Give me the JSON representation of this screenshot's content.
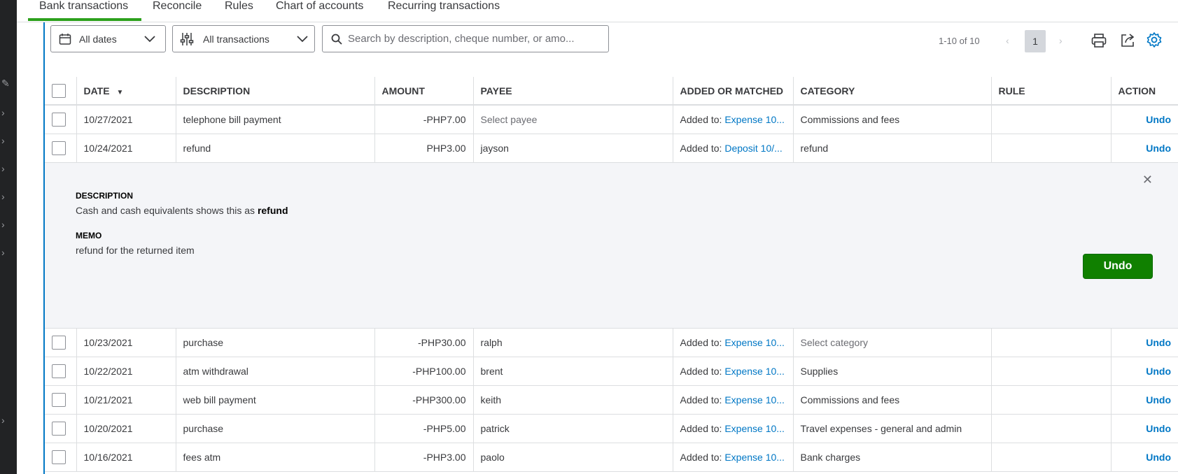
{
  "tabs": [
    {
      "label": "Bank transactions"
    },
    {
      "label": "Reconcile"
    },
    {
      "label": "Rules"
    },
    {
      "label": "Chart of accounts"
    },
    {
      "label": "Recurring transactions"
    }
  ],
  "filters": {
    "dates_label": "All dates",
    "transactions_label": "All transactions",
    "search_placeholder": "Search by description, cheque number, or amo..."
  },
  "pagination": {
    "range_text": "1-10 of 10",
    "current_page": "1"
  },
  "columns": {
    "date": "DATE",
    "description": "DESCRIPTION",
    "amount": "AMOUNT",
    "payee": "PAYEE",
    "added_or_matched": "ADDED OR MATCHED",
    "category": "CATEGORY",
    "rule": "RULE",
    "action": "ACTION"
  },
  "added_prefix": "Added to:",
  "rows": [
    {
      "date": "10/27/2021",
      "description": "telephone bill payment",
      "amount": "-PHP7.00",
      "payee": "Select payee",
      "matched": "Expense 10...",
      "category": "Commissions and fees",
      "rule": "",
      "action": "Undo"
    },
    {
      "date": "10/24/2021",
      "description": "refund",
      "amount": "PHP3.00",
      "payee": "jayson",
      "matched": "Deposit 10/...",
      "category": "refund",
      "rule": "",
      "action": "Undo"
    },
    {
      "date": "10/23/2021",
      "description": "purchase",
      "amount": "-PHP30.00",
      "payee": "ralph",
      "matched": "Expense 10...",
      "category": "Select category",
      "rule": "",
      "action": "Undo"
    },
    {
      "date": "10/22/2021",
      "description": "atm withdrawal",
      "amount": "-PHP100.00",
      "payee": "brent",
      "matched": "Expense 10...",
      "category": "Supplies",
      "rule": "",
      "action": "Undo"
    },
    {
      "date": "10/21/2021",
      "description": "web bill payment",
      "amount": "-PHP300.00",
      "payee": "keith",
      "matched": "Expense 10...",
      "category": "Commissions and fees",
      "rule": "",
      "action": "Undo"
    },
    {
      "date": "10/20/2021",
      "description": "purchase",
      "amount": "-PHP5.00",
      "payee": "patrick",
      "matched": "Expense 10...",
      "category": "Travel expenses - general and admin",
      "rule": "",
      "action": "Undo"
    },
    {
      "date": "10/16/2021",
      "description": "fees atm",
      "amount": "-PHP3.00",
      "payee": "paolo",
      "matched": "Expense 10...",
      "category": "Bank charges",
      "rule": "",
      "action": "Undo"
    }
  ],
  "detail": {
    "description_label": "DESCRIPTION",
    "description_prefix": "Cash and cash equivalents shows this as",
    "description_value": "refund",
    "memo_label": "MEMO",
    "memo_value": "refund for the returned item",
    "undo_label": "Undo"
  },
  "colors": {
    "accent_green": "#2ca01c",
    "button_green": "#108000",
    "link_blue": "#0077c5",
    "panel_border": "#0077c5"
  }
}
